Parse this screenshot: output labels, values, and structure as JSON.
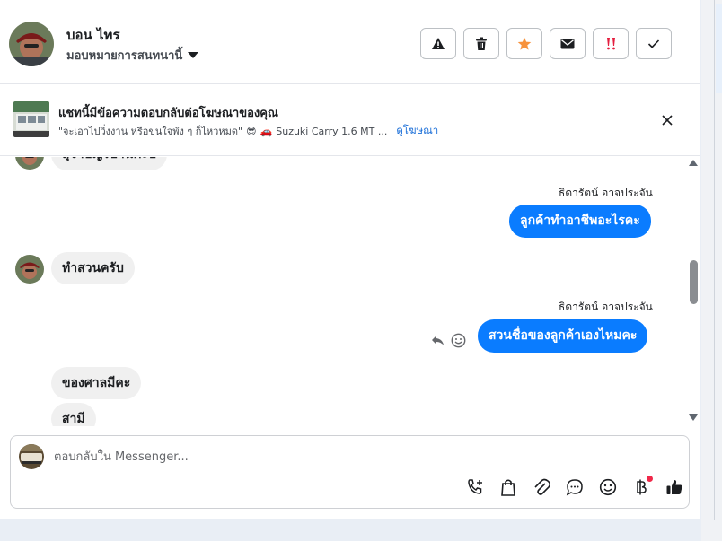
{
  "contact": {
    "name": "บอน ไทร",
    "assign_label": "มอบหมายการสนทนานี้"
  },
  "header_actions": [
    {
      "name": "spam-icon"
    },
    {
      "name": "trash-icon"
    },
    {
      "name": "star-icon",
      "color": "#f7923b"
    },
    {
      "name": "mail-icon"
    },
    {
      "name": "follow-up-icon",
      "color": "#e41e3f"
    },
    {
      "name": "check-icon"
    }
  ],
  "ad": {
    "title": "แชทนี้มีข้อความตอบกลับต่อโฆษณาของคุณ",
    "snippet_quote": "\"จะเอาไปวิ่งงาน หรือขนใจพัง ๆ ก็ไหวหมด\"",
    "snippet_emoji": "😎",
    "snippet_car": "🚗",
    "snippet_model": "Suzuki Carry 1.6 MT ...",
    "view_ad_link": "ดูโฆษณา"
  },
  "messages": {
    "cut_off_text": "สุจาบญรบานค่ะบ",
    "sender_1": "ธิดารัตน์ อาจประจัน",
    "out_1": "ลูกค้าทำอาชีพอะไรคะ",
    "in_1": "ทำสวนครับ",
    "sender_2": "ธิดารัตน์ อาจประจัน",
    "out_2": "สวนชื่อของลูกค้าเองไหมคะ",
    "in_2": "ของศาลมีคะ",
    "in_3": "สามี"
  },
  "composer": {
    "placeholder": "ตอบกลับใน Messenger..."
  },
  "colors": {
    "accent": "#0a7cff",
    "link": "#1a6ed8",
    "notification_dot": "#f02849"
  }
}
